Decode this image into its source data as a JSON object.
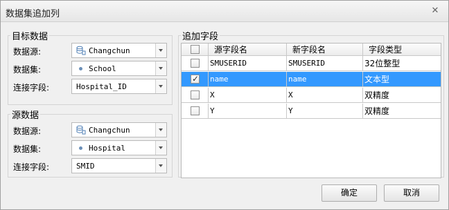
{
  "window": {
    "title": "数据集追加列"
  },
  "target": {
    "group_title": "目标数据",
    "datasource_label": "数据源:",
    "datasource_value": "Changchun",
    "dataset_label": "数据集:",
    "dataset_value": "School",
    "join_field_label": "连接字段:",
    "join_field_value": "Hospital_ID"
  },
  "source": {
    "group_title": "源数据",
    "datasource_label": "数据源:",
    "datasource_value": "Changchun",
    "dataset_label": "数据集:",
    "dataset_value": "Hospital",
    "join_field_label": "连接字段:",
    "join_field_value": "SMID"
  },
  "fields": {
    "group_title": "追加字段",
    "columns": [
      "源字段名",
      "新字段名",
      "字段类型"
    ],
    "rows": [
      {
        "checked": false,
        "source": "SMUSERID",
        "new": "SMUSERID",
        "type": "32位整型",
        "selected": false
      },
      {
        "checked": true,
        "source": "name",
        "new": "name",
        "type": "文本型",
        "selected": true
      },
      {
        "checked": false,
        "source": "X",
        "new": "X",
        "type": "双精度",
        "selected": false
      },
      {
        "checked": false,
        "source": "Y",
        "new": "Y",
        "type": "双精度",
        "selected": false
      }
    ]
  },
  "buttons": {
    "ok_label": "确定",
    "cancel_label": "取消"
  }
}
